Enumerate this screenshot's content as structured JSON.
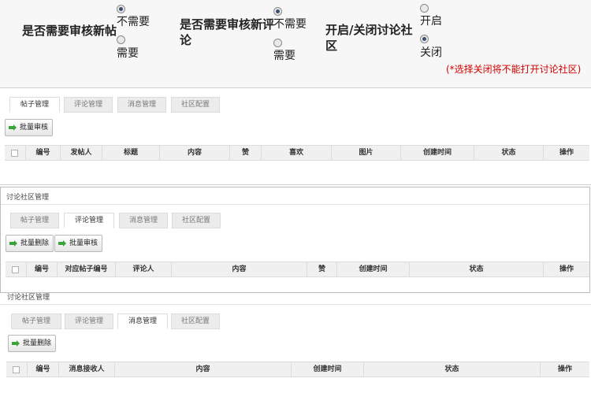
{
  "settings": {
    "post_review": {
      "label_line1": "是否需要审核新帖",
      "option_no": "不需要",
      "option_yes": "需要"
    },
    "comment_review": {
      "label_line1": "是否需要审核新评",
      "label_line2": "论",
      "option_no": "不需要",
      "option_yes": "需要"
    },
    "community_toggle": {
      "label_line1": "开启/关闭讨论社",
      "label_line2": "区",
      "option_open": "开启",
      "option_close": "关闭"
    },
    "note": "(*选择关闭将不能打开讨论社区)"
  },
  "tabs": [
    "帖子管理",
    "评论管理",
    "消息管理",
    "社区配置"
  ],
  "panel_title": "讨论社区管理",
  "buttons": {
    "batch_review": "批量审核",
    "batch_delete": "批量删除"
  },
  "posts_table": {
    "headers": [
      "编号",
      "发帖人",
      "标题",
      "内容",
      "赞",
      "喜欢",
      "图片",
      "创建时间",
      "状态",
      "操作"
    ]
  },
  "comments_table": {
    "headers": [
      "编号",
      "对应帖子编号",
      "评论人",
      "内容",
      "赞",
      "创建时间",
      "状态",
      "操作"
    ]
  },
  "messages_table": {
    "headers": [
      "编号",
      "消息接收人",
      "内容",
      "创建时间",
      "状态",
      "操作"
    ]
  },
  "colors": {
    "note_red": "#d40000",
    "tab_bg": "#ececec",
    "header_bg": "#f0f0f0"
  }
}
